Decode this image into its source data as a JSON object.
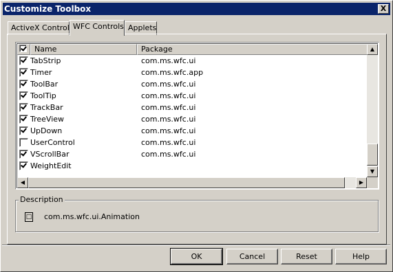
{
  "window": {
    "title": "Customize Toolbox",
    "close_label": "X"
  },
  "tabs": [
    {
      "label": "ActiveX Controls"
    },
    {
      "label": "WFC Controls"
    },
    {
      "label": "Applets"
    }
  ],
  "list": {
    "headers": {
      "check": "",
      "name": "Name",
      "package": "Package"
    },
    "rows": [
      {
        "checked": true,
        "name": "TabStrip",
        "package": "com.ms.wfc.ui"
      },
      {
        "checked": true,
        "name": "Timer",
        "package": "com.ms.wfc.app"
      },
      {
        "checked": true,
        "name": "ToolBar",
        "package": "com.ms.wfc.ui"
      },
      {
        "checked": true,
        "name": "ToolTip",
        "package": "com.ms.wfc.ui"
      },
      {
        "checked": true,
        "name": "TrackBar",
        "package": "com.ms.wfc.ui"
      },
      {
        "checked": true,
        "name": "TreeView",
        "package": "com.ms.wfc.ui"
      },
      {
        "checked": true,
        "name": "UpDown",
        "package": "com.ms.wfc.ui"
      },
      {
        "checked": false,
        "name": "UserControl",
        "package": "com.ms.wfc.ui"
      },
      {
        "checked": true,
        "name": "VScrollBar",
        "package": "com.ms.wfc.ui"
      },
      {
        "checked": true,
        "name": "WeightEdit",
        "package": ""
      }
    ]
  },
  "description": {
    "label": "Description",
    "icon": "component-icon",
    "text": "com.ms.wfc.ui.Animation"
  },
  "buttons": {
    "ok": "OK",
    "cancel": "Cancel",
    "reset": "Reset",
    "help": "Help"
  },
  "colors": {
    "titlebar": "#0a246a",
    "face": "#d4d0c8"
  }
}
